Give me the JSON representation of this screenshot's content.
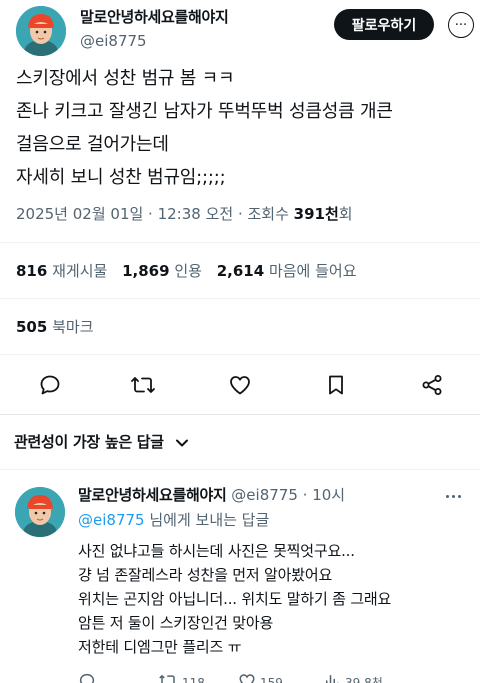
{
  "post": {
    "author_name": "말로안녕하세요를해야지",
    "author_handle": "@ei8775",
    "follow_label": "팔로우하기",
    "more_label": "···",
    "text_lines": [
      "스키장에서 성찬 범규 봄 ㅋㅋ",
      "존나 키크고 잘생긴 남자가 뚜벅뚜벅 성큼성큼 개큰",
      "걸음으로 걸어가는데",
      "자세히 보니 성찬 범규임;;;;;"
    ],
    "date": "2025년 02월 01일 · 12:38 오전 · 조회수",
    "views_num": "391천",
    "views_suffix": "회"
  },
  "stats": {
    "reposts_num": "816",
    "reposts_label": "재게시물",
    "quotes_num": "1,869",
    "quotes_label": "인용",
    "likes_num": "2,614",
    "likes_label": "마음에 들어요",
    "bookmarks_num": "505",
    "bookmarks_label": "북마크"
  },
  "actions": [
    "reply-icon",
    "repost-icon",
    "like-icon",
    "bookmark-icon",
    "share-icon"
  ],
  "sort_label": "관련성이 가장 높은 답글",
  "reply": {
    "author_name": "말로안녕하세요를해야지",
    "author_handle": "@ei8775",
    "time": "· 10시",
    "replying_handle": "@ei8775",
    "replying_suffix": " 님에게 보내는 답글",
    "text_lines": [
      "사진 없냐고들 하시는데 사진은 못찍엇구요...",
      "걍 넘 존잘레스라 성찬을 먼저 알아봤어요",
      "위치는 곤지암 아닙니더... 위치도 말하기 좀 그래요",
      "암튼 저 둘이 스키장인건 맞아용",
      "저한테 디엠그만 플리즈 ㅠ"
    ],
    "counts": {
      "replies": "",
      "reposts": "118",
      "likes": "159",
      "views": "39.8천"
    }
  },
  "colors": {
    "text": "#0f1419",
    "secondary": "#536471",
    "link": "#1d9bf0",
    "button_bg": "#0f1419"
  }
}
